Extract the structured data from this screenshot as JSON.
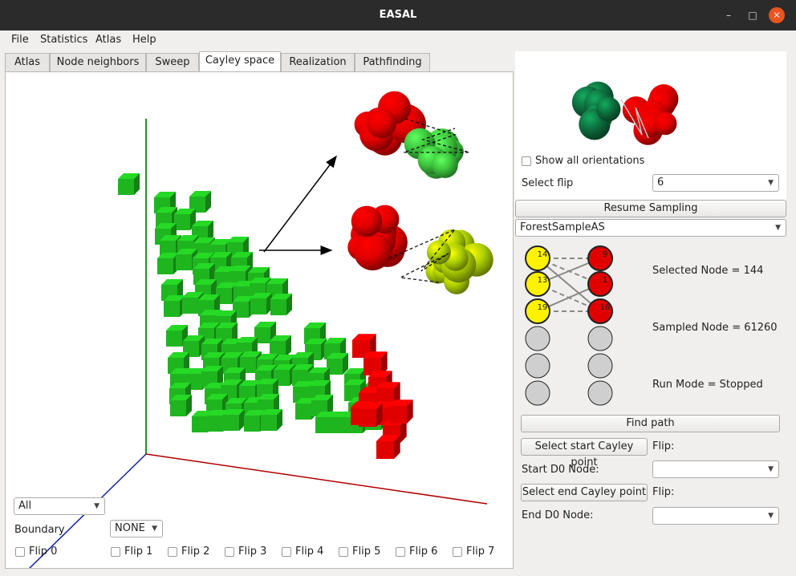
{
  "window": {
    "title": "EASAL"
  },
  "menu": [
    "File",
    "Statistics",
    "Atlas",
    "Help"
  ],
  "tabs": [
    "Atlas",
    "Node neighbors",
    "Sweep",
    "Cayley space",
    "Realization",
    "Pathfinding"
  ],
  "viewport": {
    "filter_value": "All",
    "boundary_label": "Boundary",
    "boundary_value": "NONE",
    "flips": [
      "Flip 0",
      "Flip 1",
      "Flip 2",
      "Flip 3",
      "Flip 4",
      "Flip 5",
      "Flip 6",
      "Flip 7"
    ]
  },
  "panel": {
    "show_all_orientations": "Show all orientations",
    "select_flip_label": "Select flip",
    "select_flip_value": "6",
    "resume_sampling": "Resume Sampling",
    "sampler_value": "ForestSampleAS",
    "selected_node": "Selected Node = 144",
    "sampled_node": "Sampled Node = 61260",
    "run_mode": "Run Mode = Stopped",
    "find_path": "Find path",
    "select_start": "Select start Cayley point",
    "flip_label_1": "Flip:",
    "start_d0_label": "Start D0 Node:",
    "select_end": "Select end Cayley point",
    "flip_label_2": "Flip:",
    "end_d0_label": "End D0 Node:"
  },
  "graph_nodes": {
    "left": [
      "14",
      "13",
      "19"
    ],
    "right": [
      "9",
      "1",
      "16"
    ]
  },
  "colors": {
    "green": "#1fb51f",
    "red": "#e00000",
    "dark_green": "#0d6b3c",
    "yellow_green": "#a8cc00",
    "yellow": "#fff200"
  }
}
